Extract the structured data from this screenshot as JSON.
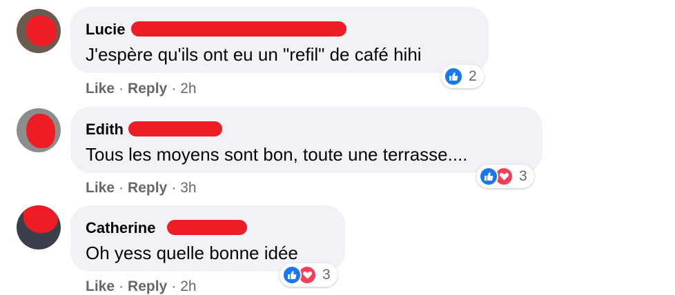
{
  "actions": {
    "like_label": "Like",
    "reply_label": "Reply",
    "separator": "·"
  },
  "colors": {
    "like_blue": "#1877f2",
    "love_red": "#f33e58",
    "redaction_red": "#ee1c25",
    "bubble_gray": "#f0f2f5"
  },
  "comments": [
    {
      "author": "Lucie",
      "text": "J'espère qu'ils ont eu un \"refil\" de café hihi",
      "time": "2h",
      "reaction_count": "2",
      "reactions": [
        "thumbs-up-icon"
      ]
    },
    {
      "author": "Edith",
      "text": "Tous les moyens sont bon, toute une terrasse....",
      "time": "3h",
      "reaction_count": "3",
      "reactions": [
        "thumbs-up-icon",
        "heart-icon"
      ]
    },
    {
      "author": "Catherine",
      "text": "Oh yess quelle bonne idée",
      "time": "2h",
      "reaction_count": "3",
      "reactions": [
        "thumbs-up-icon",
        "heart-icon"
      ]
    }
  ]
}
